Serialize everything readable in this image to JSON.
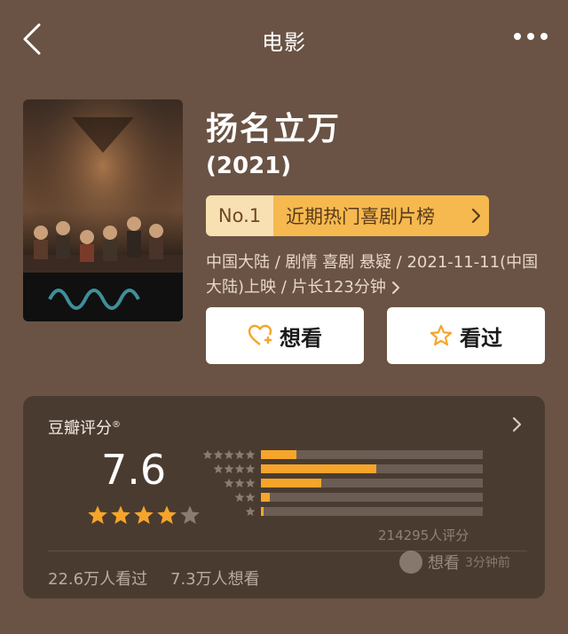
{
  "header": {
    "title": "电影",
    "back_icon": "chevron-left-icon",
    "more_icon": "more-horizontal-icon"
  },
  "movie": {
    "title": "扬名立万",
    "year": "(2021)",
    "rank": {
      "no": "No.1",
      "name": "近期热门喜剧片榜"
    },
    "meta": "中国大陆 / 剧情 喜剧 悬疑 / 2021-11-11(中国大陆)上映 / 片长123分钟",
    "want_label": "想看",
    "seen_label": "看过"
  },
  "rating": {
    "title": "豆瓣评分",
    "mark": "®",
    "score": "7.6",
    "stars": 3.8,
    "distribution": [
      {
        "stars": 5,
        "fraction": 0.16
      },
      {
        "stars": 4,
        "fraction": 0.52
      },
      {
        "stars": 3,
        "fraction": 0.27
      },
      {
        "stars": 2,
        "fraction": 0.04
      },
      {
        "stars": 1,
        "fraction": 0.01
      }
    ],
    "votes": "214295人评分",
    "watched": "22.6万人看过",
    "wanted": "7.3万人想看"
  },
  "toast": {
    "action": "想看",
    "time": "3分钟前"
  },
  "colors": {
    "background": "#6a5344",
    "card": "#4a3b31",
    "accent": "#f6a52a",
    "rank_bg": "#f6b94f",
    "rank_no_bg": "#f9e0b2"
  }
}
